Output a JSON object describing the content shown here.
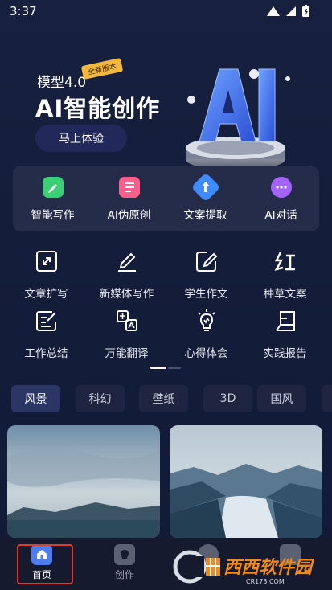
{
  "status": {
    "time": "3:37"
  },
  "hero": {
    "badge": "全新版本",
    "subtitle": "模型4.0",
    "title": "AI智能创作",
    "cta_label": "马上体验",
    "art_text": "AI"
  },
  "primary_tools": [
    {
      "label": "智能写作",
      "icon": "pencil-icon",
      "color": "#3ccf74"
    },
    {
      "label": "AI伪原创",
      "icon": "document-icon",
      "color": "#ff5f8a"
    },
    {
      "label": "文案提取",
      "icon": "upload-icon",
      "color": "#3f8cff"
    },
    {
      "label": "AI对话",
      "icon": "chat-bubble-icon",
      "color": "#a463ff"
    }
  ],
  "secondary_tools": [
    {
      "label": "文章扩写",
      "icon": "expand-icon"
    },
    {
      "label": "新媒体写作",
      "icon": "pen-write-icon"
    },
    {
      "label": "学生作文",
      "icon": "edit-square-icon"
    },
    {
      "label": "种草文案",
      "icon": "red-character-icon"
    },
    {
      "label": "工作总结",
      "icon": "note-edit-icon"
    },
    {
      "label": "万能翻译",
      "icon": "translate-icon"
    },
    {
      "label": "心得体会",
      "icon": "lightbulb-icon"
    },
    {
      "label": "实践报告",
      "icon": "report-icon"
    }
  ],
  "category_tabs": [
    {
      "label": "风景",
      "active": true
    },
    {
      "label": "科幻",
      "active": false
    },
    {
      "label": "壁纸",
      "active": false
    },
    {
      "label": "3D",
      "active": false
    },
    {
      "label": "国风",
      "active": false
    }
  ],
  "bottom_nav": [
    {
      "label": "首页",
      "icon": "home-icon",
      "active": true
    },
    {
      "label": "创作",
      "icon": "bulb-icon",
      "active": false
    }
  ],
  "watermark": {
    "text": "西西软件园",
    "sub": "CR173.COM"
  },
  "colors": {
    "accent": "#2b3566",
    "highlight": "#e23b2e",
    "home_icon": "#4f7df0"
  }
}
